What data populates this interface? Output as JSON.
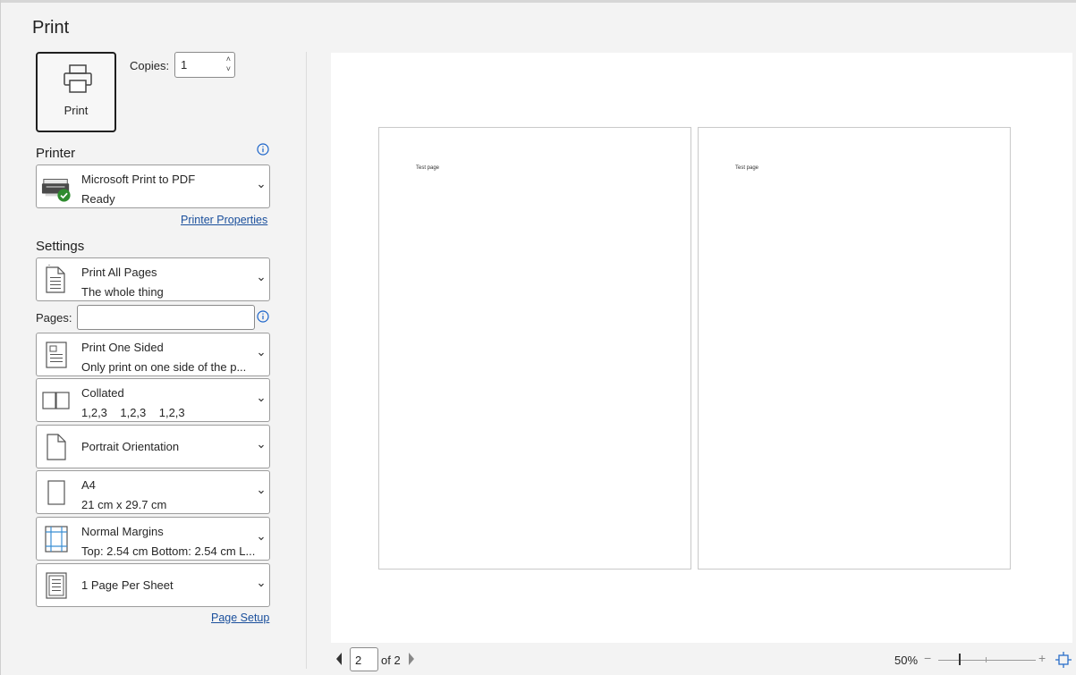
{
  "panel": {
    "title": "Print",
    "print_button": "Print",
    "copies_label": "Copies:",
    "copies_value": "1"
  },
  "printer": {
    "heading": "Printer",
    "name": "Microsoft Print to PDF",
    "status": "Ready",
    "properties_link": "Printer Properties"
  },
  "settings": {
    "heading": "Settings",
    "pages_label": "Pages:",
    "pages_value": "",
    "items": [
      {
        "title": "Print All Pages",
        "subtitle": "The whole thing",
        "icon": "pages-icon"
      },
      {
        "title": "Print One Sided",
        "subtitle": "Only print on one side of the p...",
        "icon": "one-sided-icon"
      },
      {
        "title": "Collated",
        "subtitle": "1,2,3    1,2,3    1,2,3",
        "icon": "collated-icon"
      },
      {
        "title": "Portrait Orientation",
        "subtitle": "",
        "icon": "portrait-icon"
      },
      {
        "title": "A4",
        "subtitle": "21 cm x 29.7 cm",
        "icon": "paper-size-icon"
      },
      {
        "title": "Normal Margins",
        "subtitle": "Top: 2.54 cm Bottom: 2.54 cm L...",
        "icon": "margins-icon"
      },
      {
        "title": "1 Page Per Sheet",
        "subtitle": "",
        "icon": "pages-per-sheet-icon"
      }
    ],
    "page_setup_link": "Page Setup"
  },
  "preview": {
    "pages": [
      {
        "text": "Test page"
      },
      {
        "text": "Test page"
      }
    ],
    "current_page": "2",
    "of_pages": "of 2",
    "zoom": "50%"
  },
  "colors": {
    "accent": "#1a4f9c",
    "status_green": "#2e8b2e"
  }
}
